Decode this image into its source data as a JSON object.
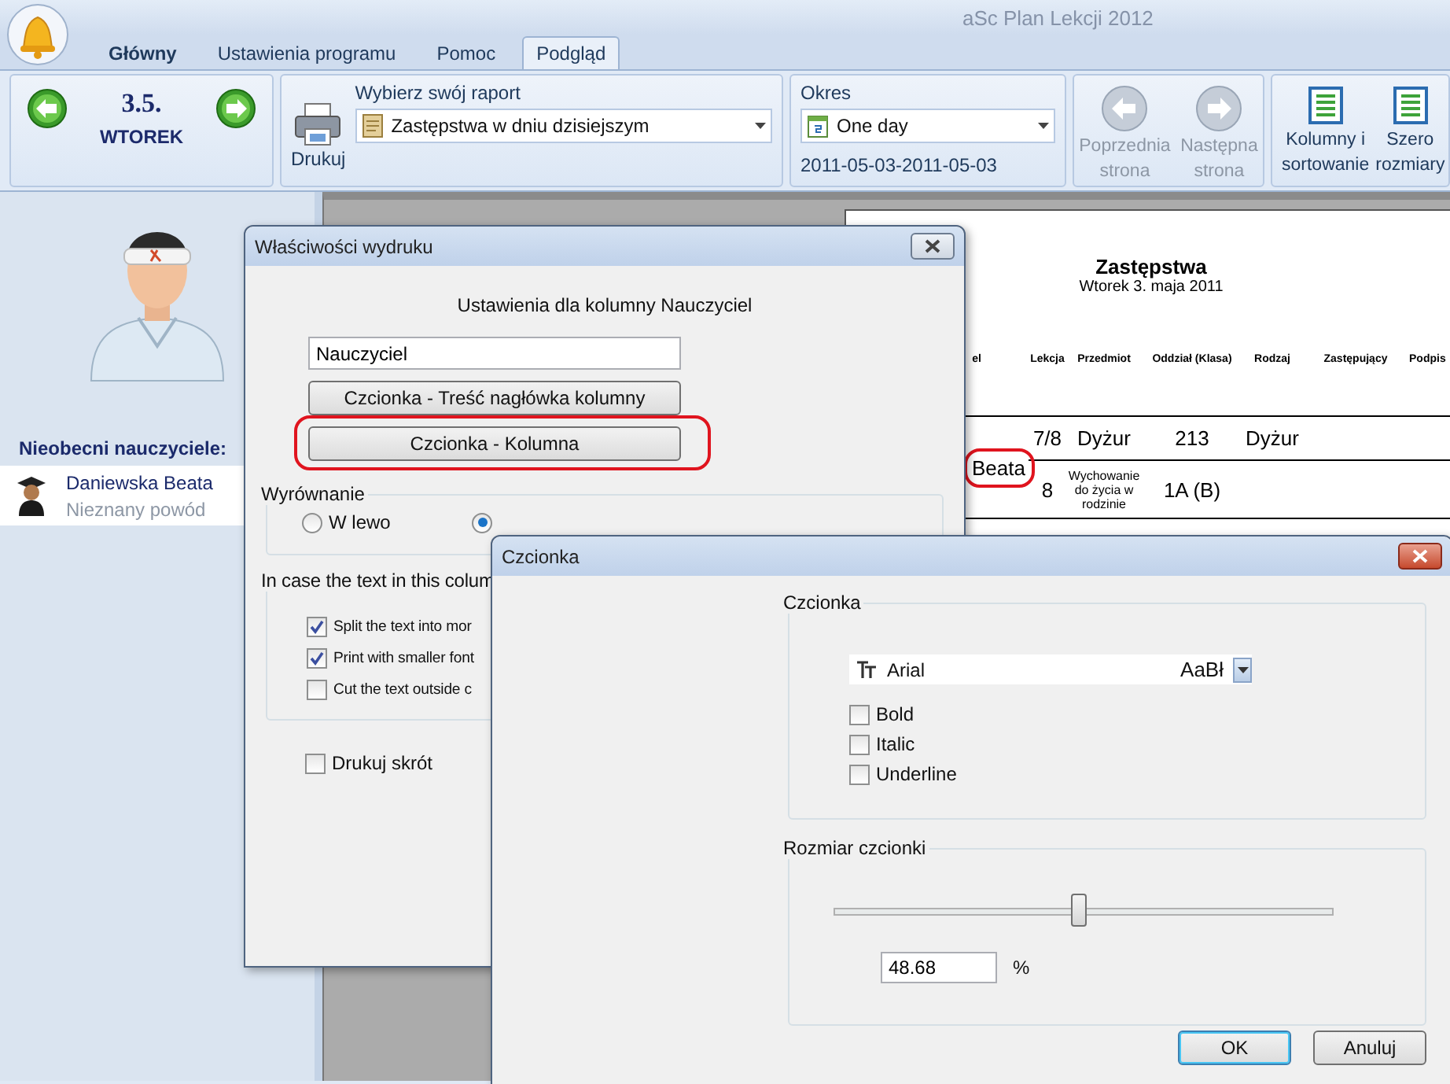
{
  "window": {
    "title": "aSc Plan Lekcji 2012"
  },
  "tabs": [
    {
      "label": "Główny",
      "kind": "home",
      "selected": false
    },
    {
      "label": "Ustawienia programu",
      "kind": "tab",
      "selected": false
    },
    {
      "label": "Pomoc",
      "kind": "tab",
      "selected": false
    },
    {
      "label": "Podgląd",
      "kind": "tab",
      "selected": true
    }
  ],
  "ribbon": {
    "date": "3.5.",
    "day": "WTOREK",
    "print_label": "Drukuj",
    "report_label": "Wybierz swój raport",
    "report_value": "Zastępstwa w dniu dzisiejszym",
    "period_label": "Okres",
    "period_value": "One day",
    "period_range": "2011-05-03-2011-05-03",
    "page_buttons": [
      {
        "lines": [
          "Poprzednia",
          "strona"
        ],
        "kind": "prev",
        "disabled": true
      },
      {
        "lines": [
          "Następna",
          "strona"
        ],
        "kind": "next",
        "disabled": true
      }
    ],
    "view_buttons": [
      {
        "lines": [
          "Kolumny i",
          "sortowanie"
        ]
      },
      {
        "lines": [
          "Szero",
          "rozmiary"
        ]
      }
    ]
  },
  "sidebar": {
    "heading": "Nieobecni nauczyciele:",
    "items": [
      {
        "name": "Daniewska Beata",
        "reason": "Nieznany powód"
      }
    ]
  },
  "preview": {
    "title": "Zastępstwa",
    "subtitle": "Wtorek 3. maja 2011",
    "columns": [
      "el",
      "Lekcja",
      "Przedmiot",
      "Oddział (Klasa)",
      "Rodzaj",
      "Zastępujący",
      "Podpis"
    ],
    "rows": [
      [
        {
          "text": "Beata",
          "rowspan": 2,
          "highlighted": true
        },
        {
          "text": "7/8"
        },
        {
          "text": "Dyżur"
        },
        {
          "text": "213"
        },
        {
          "text": "Dyżur"
        }
      ],
      [
        {
          "text": "8"
        },
        {
          "text": "Wychowanie do życia w rodzinie"
        },
        {
          "text": "1A (B)"
        }
      ]
    ]
  },
  "dialog_print": {
    "title": "Właściwości wydruku",
    "heading": "Ustawienia dla kolumny Nauczyciel",
    "name_value": "Nauczyciel",
    "buttons": [
      {
        "label": "Czcionka - Treść nagłówka kolumny",
        "highlighted": false
      },
      {
        "label": "Czcionka - Kolumna",
        "highlighted": true
      }
    ],
    "alignment": {
      "title": "Wyrównanie",
      "options": [
        {
          "label": "W lewo",
          "selected": false
        },
        {
          "selected": true
        }
      ]
    },
    "overflow": {
      "title": "In case the text in this colum",
      "options": [
        {
          "label": "Split the text into mor",
          "checked": true
        },
        {
          "label": "Print with smaller font",
          "checked": true
        },
        {
          "label": "Cut the text outside c",
          "checked": false
        }
      ]
    },
    "abbrev": {
      "label": "Drukuj skrót",
      "checked": false
    }
  },
  "dialog_font": {
    "title": "Czcionka",
    "font_group": "Czcionka",
    "font": "Arial",
    "sample": "AaBł",
    "styles": [
      {
        "label": "Bold",
        "checked": false
      },
      {
        "label": "Italic",
        "checked": false
      },
      {
        "label": "Underline",
        "checked": false
      }
    ],
    "size_group": "Rozmiar czcionki",
    "size": {
      "level": 0.49
    },
    "size_value": "48.68",
    "unit": "%",
    "buttons": [
      {
        "label": "OK",
        "default": true
      },
      {
        "label": "Anuluj",
        "default": false
      }
    ]
  }
}
